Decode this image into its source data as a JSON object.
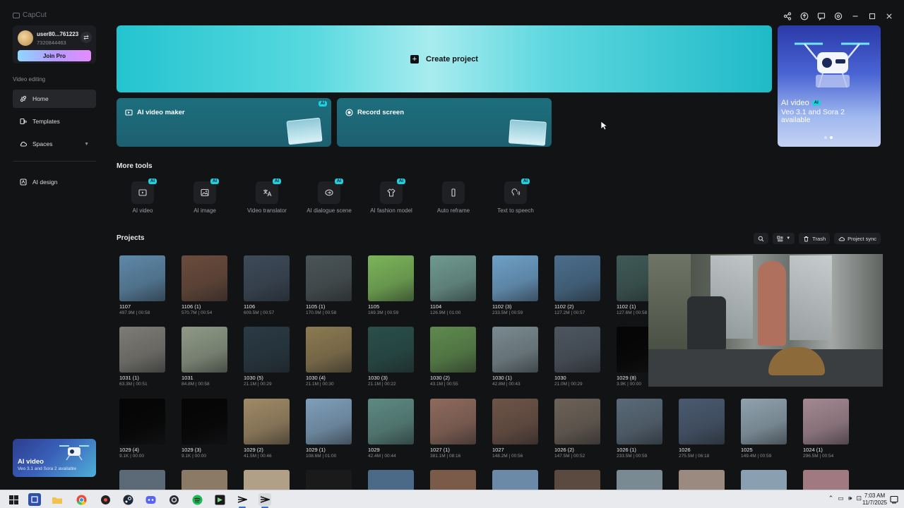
{
  "app": {
    "brand": "CapCut"
  },
  "user": {
    "name": "user80...761223",
    "id": "7320844463",
    "join_pro": "Join Pro"
  },
  "sidebar": {
    "section_label": "Video editing",
    "items": [
      {
        "label": "Home",
        "icon": "home-icon",
        "active": true
      },
      {
        "label": "Templates",
        "icon": "templates-icon",
        "active": false
      },
      {
        "label": "Spaces",
        "icon": "cloud-icon",
        "active": false
      },
      {
        "label": "AI design",
        "icon": "ai-design-icon",
        "active": false
      }
    ],
    "promo": {
      "title": "AI video",
      "subtitle": "Veo 3.1 and Sora 2 available"
    }
  },
  "main": {
    "create_project": "Create project",
    "feature_cards": [
      {
        "label": "AI video maker",
        "badge": "AI"
      },
      {
        "label": "Record screen",
        "badge": ""
      }
    ],
    "promo": {
      "title": "AI video",
      "badge": "AI",
      "subtitle": "Veo 3.1 and Sora 2 available"
    },
    "more_tools_title": "More tools",
    "tools": [
      {
        "label": "AI video",
        "badge": "AI",
        "icon": "ai-video-icon"
      },
      {
        "label": "AI image",
        "badge": "AI",
        "icon": "ai-image-icon"
      },
      {
        "label": "Video translator",
        "badge": "AI",
        "icon": "translate-icon"
      },
      {
        "label": "AI dialogue scene",
        "badge": "AI",
        "icon": "dialogue-icon"
      },
      {
        "label": "AI fashion model",
        "badge": "AI",
        "icon": "fashion-icon"
      },
      {
        "label": "Auto reframe",
        "badge": "",
        "icon": "reframe-icon"
      },
      {
        "label": "Text to speech",
        "badge": "AI",
        "icon": "speech-icon"
      }
    ],
    "projects_title": "Projects",
    "project_tools": {
      "trash": "Trash",
      "sync": "Project sync"
    },
    "projects": [
      {
        "name": "1107",
        "meta": "497.9M | 00:58",
        "color": "#5e88a8"
      },
      {
        "name": "1106 (1)",
        "meta": "570.7M | 00:54",
        "color": "#6a4c3c"
      },
      {
        "name": "1106",
        "meta": "609.5M | 00:57",
        "color": "#3d4a58"
      },
      {
        "name": "1105 (1)",
        "meta": "170.0M | 00:58",
        "color": "#4a5456"
      },
      {
        "name": "1105",
        "meta": "169.3M | 00:59",
        "color": "#7bb55a"
      },
      {
        "name": "1104",
        "meta": "126.9M | 01:00",
        "color": "#6f9a8f"
      },
      {
        "name": "1102 (3)",
        "meta": "233.5M | 00:59",
        "color": "#6ea0c8"
      },
      {
        "name": "1102 (2)",
        "meta": "127.2M | 00:57",
        "color": "#4b6e8c"
      },
      {
        "name": "1102 (1)",
        "meta": "127.6M | 00:58",
        "color": "#3f5a56"
      },
      {
        "name": "1031 (1)",
        "meta": "63.3M | 00:51",
        "color": "#7d7c76"
      },
      {
        "name": "1031",
        "meta": "84.8M | 00:58",
        "color": "#8e9a86"
      },
      {
        "name": "1030 (5)",
        "meta": "21.1M | 00:29",
        "color": "#2a3a44"
      },
      {
        "name": "1030 (4)",
        "meta": "21.1M | 00:30",
        "color": "#8c7a52"
      },
      {
        "name": "1030 (3)",
        "meta": "21.1M | 00:22",
        "color": "#2a4f4a"
      },
      {
        "name": "1030 (2)",
        "meta": "43.1M | 00:55",
        "color": "#5f8a4e"
      },
      {
        "name": "1030 (1)",
        "meta": "42.8M | 00:43",
        "color": "#7a8a90"
      },
      {
        "name": "1030",
        "meta": "21.0M | 00:29",
        "color": "#4d5660"
      },
      {
        "name": "1029 (8)",
        "meta": "3.9K | 00:00",
        "color": "#050505"
      },
      {
        "name": "1029 (4)",
        "meta": "9.1K | 00:00",
        "color": "#050505"
      },
      {
        "name": "1029 (3)",
        "meta": "9.1K | 00:00",
        "color": "#050505"
      },
      {
        "name": "1029 (2)",
        "meta": "41.5M | 00:46",
        "color": "#a08a66"
      },
      {
        "name": "1029 (1)",
        "meta": "108.6M | 01:00",
        "color": "#7f9fba"
      },
      {
        "name": "1029",
        "meta": "42.4M | 00:44",
        "color": "#5d8a82"
      },
      {
        "name": "1027 (1)",
        "meta": "381.1M | 08:16",
        "color": "#8e6a5c"
      },
      {
        "name": "1027",
        "meta": "148.2M | 00:56",
        "color": "#6e5448"
      },
      {
        "name": "1026 (2)",
        "meta": "147.5M | 00:52",
        "color": "#6d6258"
      },
      {
        "name": "1026 (1)",
        "meta": "233.5M | 00:59",
        "color": "#5a6a78"
      },
      {
        "name": "1026",
        "meta": "275.5M | 06:18",
        "color": "#4a5a70"
      },
      {
        "name": "1025",
        "meta": "149.4M | 00:59",
        "color": "#8fa2ae"
      },
      {
        "name": "1024 (1)",
        "meta": "296.5M | 00:54",
        "color": "#a48892"
      }
    ],
    "partial_row_colors": [
      "#5c6a78",
      "#8a7a66",
      "#b0a088",
      "#1a1a1a",
      "#4a6a88",
      "#7a5a48",
      "#6a8aa8",
      "#5a4a40",
      "#7a8a92",
      "#9a8a80",
      "#8aa0b0",
      "#a07a80"
    ]
  },
  "taskbar": {
    "time": "7:03 AM",
    "date": "11/7/2025",
    "apps": [
      "windows-start-icon",
      "journal-icon",
      "file-explorer-icon",
      "chrome-icon",
      "media-player-icon",
      "steam-icon",
      "discord-icon",
      "overlay-app-icon",
      "spotify-icon",
      "terminal-app-icon",
      "capcut-icon",
      "capcut-active-icon"
    ]
  },
  "colors": {
    "accent": "#1ed0e0",
    "banner": "#23c4cf",
    "background": "#121315"
  }
}
